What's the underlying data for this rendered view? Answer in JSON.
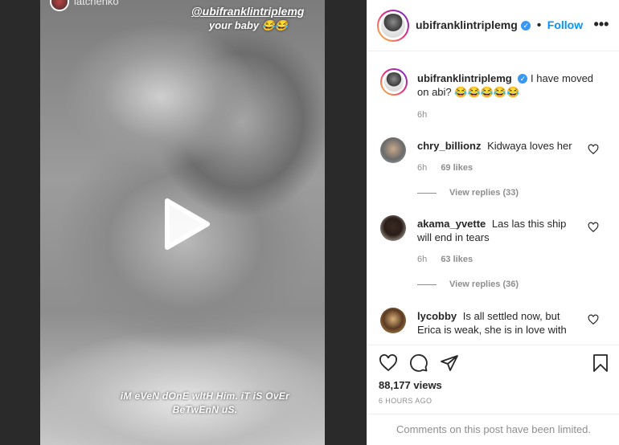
{
  "media": {
    "story_username": "latchenko",
    "mention": "@ubifranklintriplemg",
    "mention_sub": "your baby 😂😂",
    "caption": "iM eVeN dOnE wItH Him. iT iS OvEr BeTwEnN uS.",
    "play_icon": "play-icon"
  },
  "header": {
    "username": "ubifranklintriplemg",
    "separator": "•",
    "follow_label": "Follow",
    "more_icon": "more-horizontal-icon",
    "verified_glyph": "✓"
  },
  "post": {
    "username": "ubifranklintriplemg",
    "caption": "I have moved on abi? 😂😂😂😂😂",
    "time": "6h"
  },
  "comments": [
    {
      "username": "chry_billionz",
      "text": "Kidwaya loves her",
      "time": "6h",
      "likes": "69 likes",
      "replies": "View replies (33)"
    },
    {
      "username": "akama_yvette",
      "text": "Las las this ship will end in tears",
      "time": "6h",
      "likes": "63 likes",
      "replies": "View replies (36)"
    },
    {
      "username": "lycobby",
      "text": "Is all settled now, but Erica is weak, she is in love with"
    }
  ],
  "actions": {
    "views": "88,177 views",
    "time_ago": "6 HOURS AGO",
    "limited_notice": "Comments on this post have been limited."
  },
  "colors": {
    "accent": "#0095f6",
    "verified": "#3897f0",
    "muted": "#8e8e8e",
    "text": "#262626"
  }
}
